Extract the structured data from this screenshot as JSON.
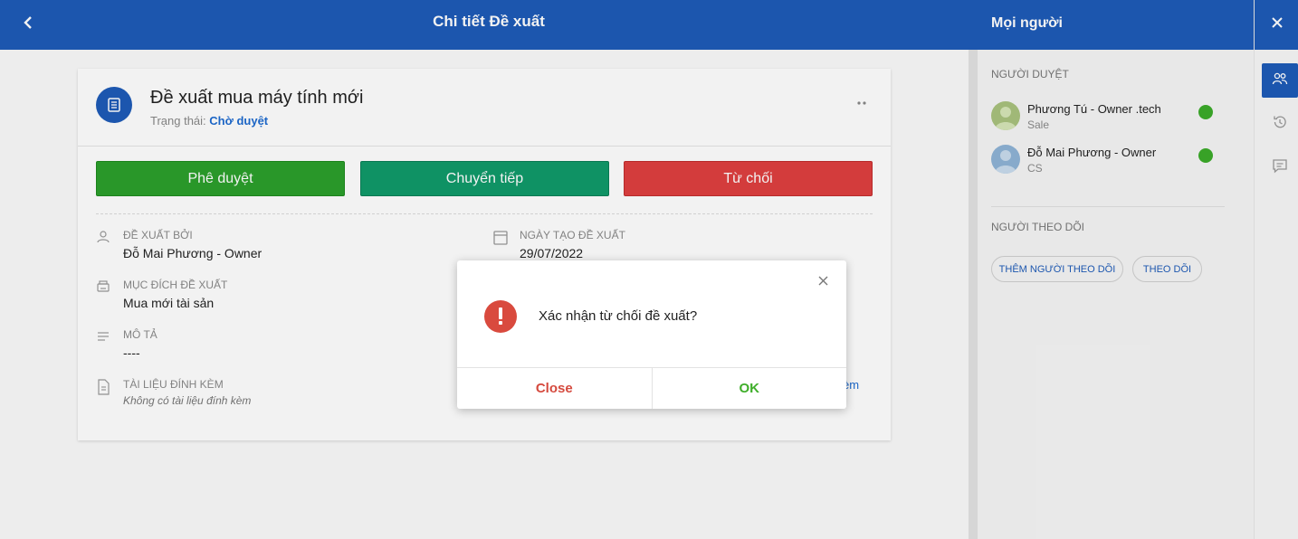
{
  "header": {
    "title": "Chi tiết Đề xuất"
  },
  "request": {
    "title": "Đề xuất mua máy tính mới",
    "status_label": "Trạng thái: ",
    "status_value": "Chờ duyệt"
  },
  "actions": {
    "approve": "Phê duyệt",
    "forward": "Chuyển tiếp",
    "reject": "Từ chối"
  },
  "fields": {
    "proposed_by": {
      "label": "ĐỀ XUẤT BỞI",
      "value": "Đỗ Mai Phương - Owner"
    },
    "created_date": {
      "label": "NGÀY TẠO ĐỀ XUẤT",
      "value": "29/07/2022"
    },
    "purpose": {
      "label": "MỤC ĐÍCH ĐỀ XUẤT",
      "value": "Mua mới tài sản"
    },
    "description": {
      "label": "MÔ TẢ",
      "value": "----"
    },
    "attachments": {
      "label": "TÀI LIỆU ĐÍNH KÈM",
      "value": "Không có tài liệu đính kèm"
    },
    "partial_link": "èm"
  },
  "panel": {
    "title": "Mọi người",
    "approvers_title": "NGƯỜI DUYỆT",
    "approvers": [
      {
        "name": "Phương Tú - Owner .tech",
        "role": "Sale",
        "status_color": "#3cab2a"
      },
      {
        "name": "Đỗ Mai Phương - Owner",
        "role": "CS",
        "status_color": "#3cab2a"
      }
    ],
    "followers_title": "NGƯỜI THEO DÕI",
    "add_follower": "THÊM NGƯỜI THEO DÕI",
    "follow": "THEO DÕI"
  },
  "dialog": {
    "message": "Xác nhận từ chối đề xuất?",
    "close": "Close",
    "ok": "OK"
  },
  "colors": {
    "brand": "#1e5bb8",
    "approve": "#2ca02c",
    "forward": "#109a6a",
    "reject": "#df4040",
    "warning": "#d94a3e"
  }
}
